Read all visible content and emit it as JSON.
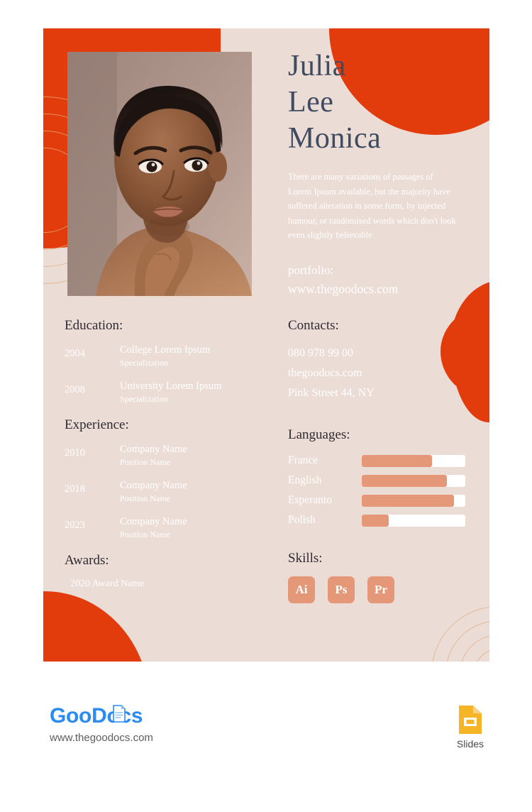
{
  "theme": {
    "card_bg": "#ecdcd6",
    "accent_orange": "#e23b0c",
    "accent_salmon": "#e59878",
    "name_color": "#3e4b60",
    "heading_color": "#2f2b33",
    "text_light": "#ffffff",
    "ring_color": "#e3ad80",
    "brand_blue": "#2a8bf2",
    "slides_yellow": "#f5b526"
  },
  "header": {
    "name_lines": [
      "Julia",
      "Lee",
      "Monica"
    ],
    "summary": "There are many variations of passages of Lorem Ipsum available, but the majority have suffered alteration in some form, by injected humour, or randomised words which don't look even slightly believable",
    "portfolio_label": "portfolio:",
    "portfolio_url": "www.thegoodocs.com"
  },
  "education": {
    "title": "Education:",
    "entries": [
      {
        "year": "2004",
        "title": "College Lorem Ipsum",
        "sub": "Specialization"
      },
      {
        "year": "2008",
        "title": "University Lorem Ipsum",
        "sub": "Specialization"
      }
    ]
  },
  "experience": {
    "title": "Experience:",
    "entries": [
      {
        "year": "2010",
        "title": "Company Name",
        "sub": "Position Name"
      },
      {
        "year": "2018",
        "title": "Company Name",
        "sub": "Position Name"
      },
      {
        "year": "2023",
        "title": "Company Name",
        "sub": "Position Name"
      }
    ]
  },
  "awards": {
    "title": "Awards:",
    "item": "2020 Award  Name"
  },
  "contacts": {
    "title": "Contacts:",
    "lines": [
      "080 978 99 00",
      "thegoodocs.com",
      "Pink Street 44, NY"
    ]
  },
  "languages": {
    "title": "Languages:",
    "items": [
      {
        "name": "France",
        "level": 68
      },
      {
        "name": "English",
        "level": 82
      },
      {
        "name": "Esperanto",
        "level": 89
      },
      {
        "name": "Polish",
        "level": 26
      }
    ]
  },
  "skills": {
    "title": "Skills:",
    "badges": [
      "Ai",
      "Ps",
      "Pr"
    ]
  },
  "photo": {
    "alt": "portrait-photo-woman"
  },
  "footer": {
    "brand_part1": "Goo",
    "brand_part2": "Docs",
    "brand_url": "www.thegoodocs.com",
    "slides_label": "Slides"
  }
}
